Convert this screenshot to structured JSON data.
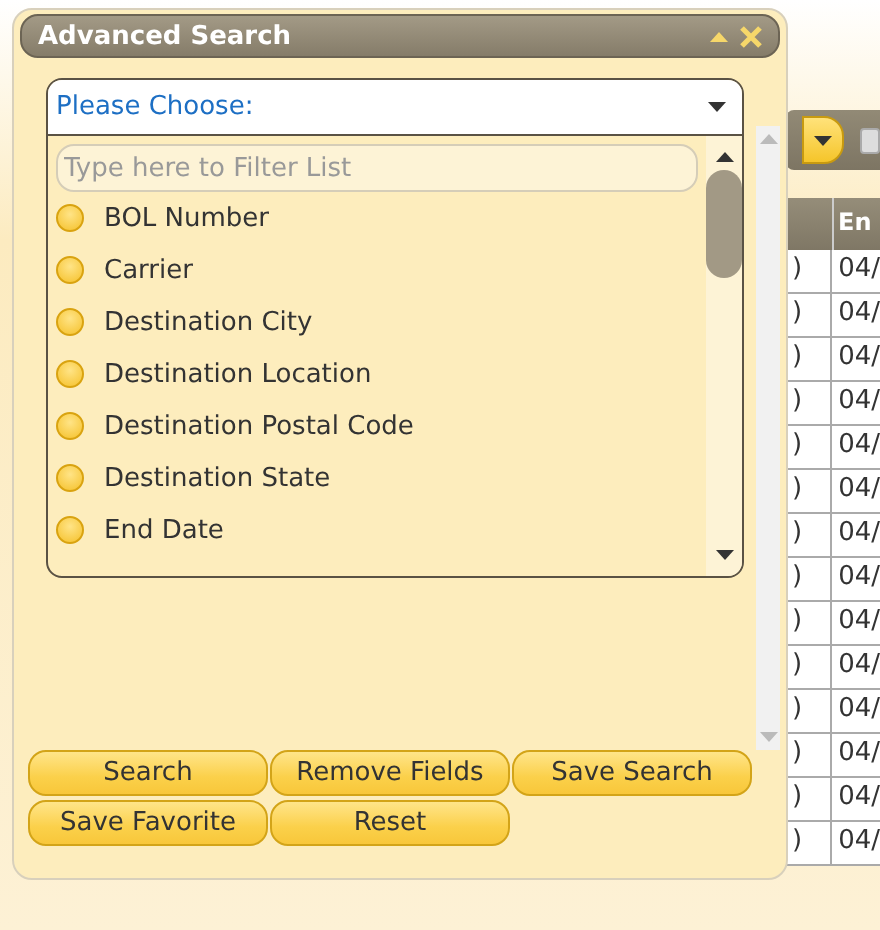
{
  "dialog": {
    "title": "Advanced Search",
    "field_select": {
      "value": "Please Choose:",
      "filter": {
        "placeholder": "Type here to Filter List"
      },
      "options": [
        {
          "label": "BOL Number"
        },
        {
          "label": "Carrier"
        },
        {
          "label": "Destination City"
        },
        {
          "label": "Destination Location"
        },
        {
          "label": "Destination Postal Code"
        },
        {
          "label": "Destination State"
        },
        {
          "label": "End Date"
        }
      ]
    },
    "buttons": [
      "Search",
      "Remove Fields",
      "Save Search",
      "Save Favorite",
      "Reset"
    ]
  },
  "toolbar": {
    "checkbox": {
      "checked": false
    }
  },
  "table": {
    "columns": [
      "En"
    ],
    "rows": [
      {
        "column_1": ")",
        "column_2": "04/"
      },
      {
        "column_1": ")",
        "column_2": "04/"
      },
      {
        "column_1": ")",
        "column_2": "04/"
      },
      {
        "column_1": ")",
        "column_2": "04/"
      },
      {
        "column_1": ")",
        "column_2": "04/"
      },
      {
        "column_1": ")",
        "column_2": "04/"
      },
      {
        "column_1": ")",
        "column_2": "04/"
      },
      {
        "column_1": ")",
        "column_2": "04/"
      },
      {
        "column_1": ")",
        "column_2": "04/"
      },
      {
        "column_1": ")",
        "column_2": "04/"
      },
      {
        "column_1": ")",
        "column_2": "04/"
      },
      {
        "column_1": ")",
        "column_2": "04/"
      },
      {
        "column_1": ")",
        "column_2": "04/"
      },
      {
        "column_1": ")",
        "column_2": "04/"
      }
    ]
  }
}
